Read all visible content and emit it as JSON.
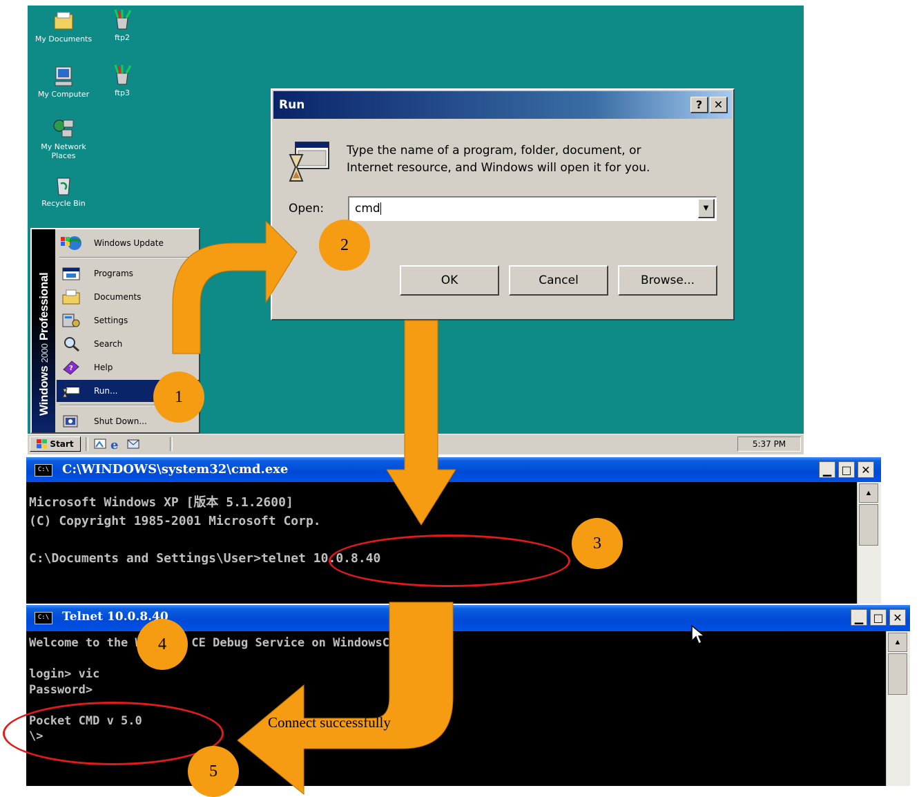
{
  "desktop": {
    "icons": [
      {
        "label": "My Documents",
        "icon": "folder-icon"
      },
      {
        "label": "ftp2",
        "icon": "ftp-icon"
      },
      {
        "label": "My Computer",
        "icon": "computer-icon"
      },
      {
        "label": "ftp3",
        "icon": "ftp-icon"
      },
      {
        "label": "My Network Places",
        "icon": "network-icon"
      },
      {
        "label": "Recycle Bin",
        "icon": "recycle-bin-icon"
      }
    ]
  },
  "start_menu": {
    "band_brand": "Windows",
    "band_version": "2000",
    "band_edition": "Professional",
    "items": [
      {
        "label": "Windows Update",
        "icon": "windows-update-icon"
      },
      {
        "label": "Programs",
        "icon": "programs-icon"
      },
      {
        "label": "Documents",
        "icon": "documents-icon"
      },
      {
        "label": "Settings",
        "icon": "settings-icon"
      },
      {
        "label": "Search",
        "icon": "search-icon"
      },
      {
        "label": "Help",
        "icon": "help-icon"
      },
      {
        "label": "Run...",
        "icon": "run-icon",
        "selected": true
      },
      {
        "label": "Shut Down...",
        "icon": "shutdown-icon"
      }
    ]
  },
  "taskbar": {
    "start_label": "Start",
    "clock": "5:37 PM"
  },
  "run_dialog": {
    "title": "Run",
    "help_btn": "?",
    "close_btn": "✕",
    "description_line1": "Type the name of a program, folder, document, or",
    "description_line2": "Internet resource, and Windows will open it for you.",
    "open_label": "Open:",
    "open_value": "cmd",
    "ok_label": "OK",
    "cancel_label": "Cancel",
    "browse_label": "Browse..."
  },
  "cmd_window": {
    "title": "C:\\WINDOWS\\system32\\cmd.exe",
    "icon_text": "C:\\",
    "lines": [
      "Microsoft Windows XP [版本 5.1.2600]",
      "(C) Copyright 1985-2001 Microsoft Corp.",
      "",
      "C:\\Documents and Settings\\User>telnet 10.0.8.40"
    ]
  },
  "telnet_window": {
    "title": "Telnet 10.0.8.40",
    "icon_text": "C:\\",
    "lines": [
      "Welcome to the Windows CE Debug Service on WindowsCE",
      "",
      "login> vic",
      "Password>",
      "",
      "Pocket CMD v 5.0",
      "\\>"
    ]
  },
  "annotations": {
    "step1": "1",
    "step2": "2",
    "step3": "3",
    "step4": "4",
    "step5": "5",
    "connect_note": "Connect successfully",
    "arrow_color": "#f59c12",
    "ellipse_color": "#e21a1a"
  },
  "colors": {
    "desktop": "#0e8a87",
    "run_title": "#0a246a",
    "xp_title": "#0049d6",
    "console_text": "#c0c0c0"
  }
}
